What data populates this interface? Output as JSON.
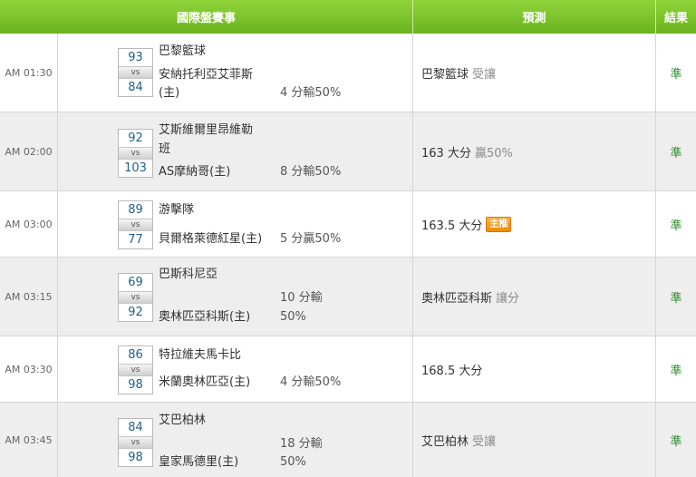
{
  "header": {
    "event": "國際盤賽事",
    "prediction": "預測",
    "result": "結果"
  },
  "rows": [
    {
      "time": "AM 01:30",
      "home_score": "93",
      "away_score": "84",
      "vs": "vs",
      "team1": "巴黎籃球",
      "team2": "安納托利亞艾菲斯(主)",
      "handicap1": "",
      "handicap2": "4 分輸50%",
      "pred_main": "巴黎籃球",
      "pred_sub": "受讓",
      "pred_tag": "",
      "result": "準"
    },
    {
      "time": "AM 02:00",
      "home_score": "92",
      "away_score": "103",
      "vs": "vs",
      "team1": "艾斯維爾里昂維勒",
      "team1b": "班",
      "team2": "AS摩納哥(主)",
      "handicap1": "",
      "handicap2": "8 分輸50%",
      "pred_main": "163 大分",
      "pred_sub": "贏50%",
      "pred_tag": "",
      "result": "準"
    },
    {
      "time": "AM 03:00",
      "home_score": "89",
      "away_score": "77",
      "vs": "vs",
      "team1": "游擊隊",
      "team2": "貝爾格萊德紅星(主)",
      "handicap1": "",
      "handicap2": "5 分贏50%",
      "pred_main": "163.5 大分",
      "pred_sub": "",
      "pred_tag": "主推",
      "result": "準"
    },
    {
      "time": "AM 03:15",
      "home_score": "69",
      "away_score": "92",
      "vs": "vs",
      "team1": "巴斯科尼亞",
      "team2": "奧林匹亞科斯(主)",
      "handicap1": "10 分輸",
      "handicap2": "50%",
      "pred_main": "奧林匹亞科斯",
      "pred_sub": "讓分",
      "pred_tag": "",
      "result": "準"
    },
    {
      "time": "AM 03:30",
      "home_score": "86",
      "away_score": "98",
      "vs": "vs",
      "team1": "特拉維夫馬卡比",
      "team2": "米蘭奧林匹亞(主)",
      "handicap1": "",
      "handicap2": "4 分輸50%",
      "pred_main": "168.5 大分",
      "pred_sub": "",
      "pred_tag": "",
      "result": "準"
    },
    {
      "time": "AM 03:45",
      "home_score": "84",
      "away_score": "98",
      "vs": "vs",
      "team1": "艾巴柏林",
      "team2": "皇家馬德里(主)",
      "handicap1": "18 分輸",
      "handicap2": "50%",
      "pred_main": "艾巴柏林",
      "pred_sub": "受讓",
      "pred_tag": "",
      "result": "準"
    }
  ]
}
